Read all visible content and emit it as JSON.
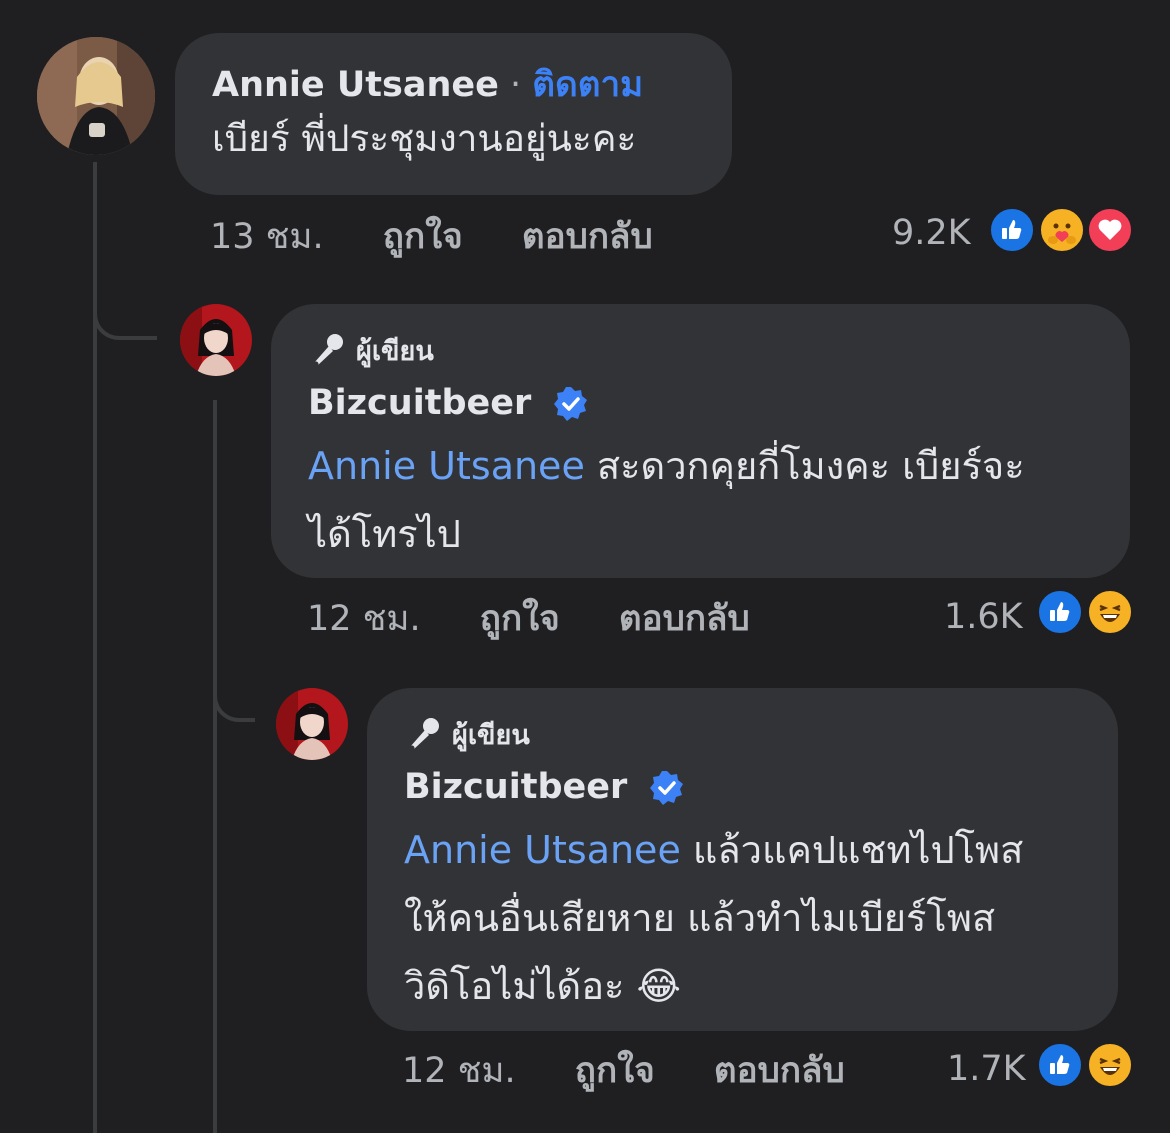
{
  "comments": [
    {
      "author": "Annie Utsanee",
      "separator": "·",
      "follow_label": "ติดตาม",
      "text": "เบียร์ พี่ประชุมงานอยู่นะคะ",
      "time": "13 ชม.",
      "like_label": "ถูกใจ",
      "reply_label": "ตอบกลับ",
      "reaction_count": "9.2K",
      "reactions": [
        "like-icon",
        "care-icon",
        "love-icon"
      ]
    },
    {
      "badge": "ผู้เขียน",
      "author": "Bizcuitbeer",
      "verified": true,
      "mention": "Annie Utsanee",
      "text_line1": " สะดวกคุยกี่โมงคะ เบียร์จะ",
      "text_line2": "ได้โทรไป",
      "time": "12 ชม.",
      "like_label": "ถูกใจ",
      "reply_label": "ตอบกลับ",
      "reaction_count": "1.6K",
      "reactions": [
        "like-icon",
        "haha-icon"
      ]
    },
    {
      "badge": "ผู้เขียน",
      "author": "Bizcuitbeer",
      "verified": true,
      "mention": "Annie Utsanee",
      "text_line1": " แล้วแคปแชทไปโพส",
      "text_line2": "ให้คนอื่นเสียหาย แล้วทำไมเบียร์โพส",
      "text_line3": "วิดิโอไม่ได้อะ 😂",
      "time": "12 ชม.",
      "like_label": "ถูกใจ",
      "reply_label": "ตอบกลับ",
      "reaction_count": "1.7K",
      "reactions": [
        "like-icon",
        "haha-icon"
      ]
    }
  ],
  "colors": {
    "background": "#1f1f21",
    "bubble": "#323336",
    "link_blue": "#3c82f6",
    "mention_blue": "#6aa2f5",
    "muted_text": "#b0b3b8"
  }
}
